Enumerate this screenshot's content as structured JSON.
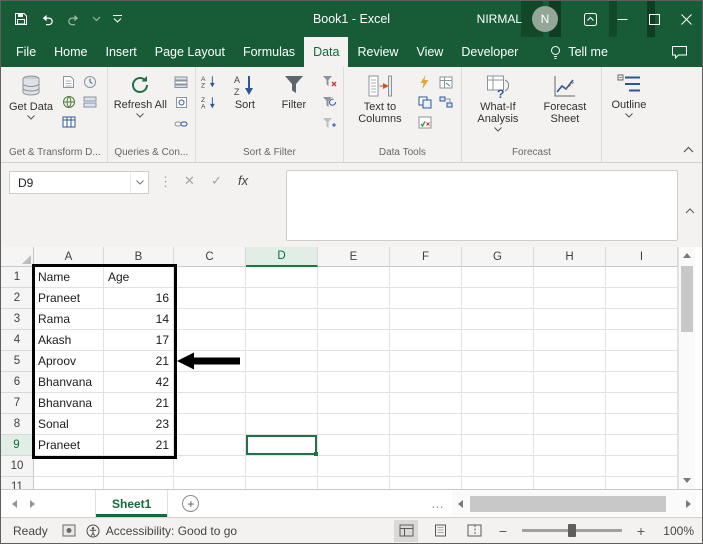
{
  "colors": {
    "title_bar_green": "#185C37",
    "excel_brand_green": "#217346",
    "selected_tab_text": "#0E6B3C",
    "table_border": "#000000",
    "arrow_annotation": "#000000"
  },
  "title_bar": {
    "title": "Book1  -  Excel",
    "user_name": "NIRMAL",
    "avatar_initial": "N"
  },
  "ribbon_tabs": {
    "items": [
      {
        "label": "File",
        "selected": false
      },
      {
        "label": "Home",
        "selected": false
      },
      {
        "label": "Insert",
        "selected": false
      },
      {
        "label": "Page Layout",
        "selected": false
      },
      {
        "label": "Formulas",
        "selected": false
      },
      {
        "label": "Data",
        "selected": true
      },
      {
        "label": "Review",
        "selected": false
      },
      {
        "label": "View",
        "selected": false
      },
      {
        "label": "Developer",
        "selected": false
      }
    ],
    "tell_me": "Tell me"
  },
  "ribbon": {
    "get_data_label": "Get Data",
    "refresh_all_label": "Refresh All",
    "sort_label": "Sort",
    "filter_label": "Filter",
    "text_to_columns_label": "Text to Columns",
    "what_if_label": "What-If Analysis",
    "forecast_sheet_label": "Forecast Sheet",
    "outline_label": "Outline",
    "group_labels": {
      "get_transform": "Get & Transform D...",
      "queries": "Queries & Con...",
      "sort_filter": "Sort & Filter",
      "data_tools": "Data Tools",
      "forecast": "Forecast"
    }
  },
  "formula_bar": {
    "name_box_value": "D9",
    "formula_value": ""
  },
  "glyphs": {
    "cancel": "✕",
    "enter": "✓",
    "fx": "fx",
    "zoom_out": "−",
    "zoom_in": "+",
    "add_sheet": "+",
    "name_box_dots": "⋮",
    "tab_overflow": "…"
  },
  "spreadsheet": {
    "column_headers": [
      "A",
      "B",
      "C",
      "D",
      "E",
      "F",
      "G",
      "H",
      "I"
    ],
    "row_count": 11,
    "active_cell": "D9",
    "active_column": "D",
    "active_row": 9,
    "cells": {
      "A1": "Name",
      "B1": "Age",
      "A2": "Praneet",
      "B2": "16",
      "A3": "Rama",
      "B3": "14",
      "A4": "Akash",
      "B4": "17",
      "A5": "Aproov",
      "B5": "21",
      "A6": "Bhanvana",
      "B6": "42",
      "A7": "Bhanvana",
      "B7": "21",
      "A8": "Sonal",
      "B8": "23",
      "A9": "Praneet",
      "B9": "21"
    },
    "table_range": "A1:B9",
    "annotation": "black arrow pointing at cell B5 value 21"
  },
  "sheet_bar": {
    "sheet_tabs": [
      {
        "label": "Sheet1",
        "active": true
      }
    ]
  },
  "status_bar": {
    "mode": "Ready",
    "accessibility": "Accessibility: Good to go",
    "zoom_level": "100%"
  }
}
